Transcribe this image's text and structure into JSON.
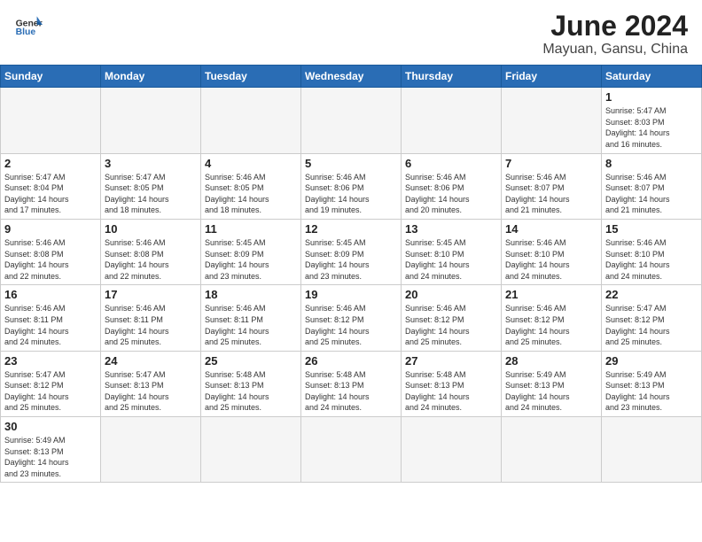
{
  "header": {
    "logo_general": "General",
    "logo_blue": "Blue",
    "title": "June 2024",
    "location": "Mayuan, Gansu, China"
  },
  "weekdays": [
    "Sunday",
    "Monday",
    "Tuesday",
    "Wednesday",
    "Thursday",
    "Friday",
    "Saturday"
  ],
  "days": [
    {
      "num": "",
      "info": ""
    },
    {
      "num": "",
      "info": ""
    },
    {
      "num": "",
      "info": ""
    },
    {
      "num": "",
      "info": ""
    },
    {
      "num": "",
      "info": ""
    },
    {
      "num": "",
      "info": ""
    },
    {
      "num": "1",
      "info": "Sunrise: 5:47 AM\nSunset: 8:03 PM\nDaylight: 14 hours\nand 16 minutes."
    },
    {
      "num": "2",
      "info": "Sunrise: 5:47 AM\nSunset: 8:04 PM\nDaylight: 14 hours\nand 17 minutes."
    },
    {
      "num": "3",
      "info": "Sunrise: 5:47 AM\nSunset: 8:05 PM\nDaylight: 14 hours\nand 18 minutes."
    },
    {
      "num": "4",
      "info": "Sunrise: 5:46 AM\nSunset: 8:05 PM\nDaylight: 14 hours\nand 18 minutes."
    },
    {
      "num": "5",
      "info": "Sunrise: 5:46 AM\nSunset: 8:06 PM\nDaylight: 14 hours\nand 19 minutes."
    },
    {
      "num": "6",
      "info": "Sunrise: 5:46 AM\nSunset: 8:06 PM\nDaylight: 14 hours\nand 20 minutes."
    },
    {
      "num": "7",
      "info": "Sunrise: 5:46 AM\nSunset: 8:07 PM\nDaylight: 14 hours\nand 21 minutes."
    },
    {
      "num": "8",
      "info": "Sunrise: 5:46 AM\nSunset: 8:07 PM\nDaylight: 14 hours\nand 21 minutes."
    },
    {
      "num": "9",
      "info": "Sunrise: 5:46 AM\nSunset: 8:08 PM\nDaylight: 14 hours\nand 22 minutes."
    },
    {
      "num": "10",
      "info": "Sunrise: 5:46 AM\nSunset: 8:08 PM\nDaylight: 14 hours\nand 22 minutes."
    },
    {
      "num": "11",
      "info": "Sunrise: 5:45 AM\nSunset: 8:09 PM\nDaylight: 14 hours\nand 23 minutes."
    },
    {
      "num": "12",
      "info": "Sunrise: 5:45 AM\nSunset: 8:09 PM\nDaylight: 14 hours\nand 23 minutes."
    },
    {
      "num": "13",
      "info": "Sunrise: 5:45 AM\nSunset: 8:10 PM\nDaylight: 14 hours\nand 24 minutes."
    },
    {
      "num": "14",
      "info": "Sunrise: 5:46 AM\nSunset: 8:10 PM\nDaylight: 14 hours\nand 24 minutes."
    },
    {
      "num": "15",
      "info": "Sunrise: 5:46 AM\nSunset: 8:10 PM\nDaylight: 14 hours\nand 24 minutes."
    },
    {
      "num": "16",
      "info": "Sunrise: 5:46 AM\nSunset: 8:11 PM\nDaylight: 14 hours\nand 24 minutes."
    },
    {
      "num": "17",
      "info": "Sunrise: 5:46 AM\nSunset: 8:11 PM\nDaylight: 14 hours\nand 25 minutes."
    },
    {
      "num": "18",
      "info": "Sunrise: 5:46 AM\nSunset: 8:11 PM\nDaylight: 14 hours\nand 25 minutes."
    },
    {
      "num": "19",
      "info": "Sunrise: 5:46 AM\nSunset: 8:12 PM\nDaylight: 14 hours\nand 25 minutes."
    },
    {
      "num": "20",
      "info": "Sunrise: 5:46 AM\nSunset: 8:12 PM\nDaylight: 14 hours\nand 25 minutes."
    },
    {
      "num": "21",
      "info": "Sunrise: 5:46 AM\nSunset: 8:12 PM\nDaylight: 14 hours\nand 25 minutes."
    },
    {
      "num": "22",
      "info": "Sunrise: 5:47 AM\nSunset: 8:12 PM\nDaylight: 14 hours\nand 25 minutes."
    },
    {
      "num": "23",
      "info": "Sunrise: 5:47 AM\nSunset: 8:12 PM\nDaylight: 14 hours\nand 25 minutes."
    },
    {
      "num": "24",
      "info": "Sunrise: 5:47 AM\nSunset: 8:13 PM\nDaylight: 14 hours\nand 25 minutes."
    },
    {
      "num": "25",
      "info": "Sunrise: 5:48 AM\nSunset: 8:13 PM\nDaylight: 14 hours\nand 25 minutes."
    },
    {
      "num": "26",
      "info": "Sunrise: 5:48 AM\nSunset: 8:13 PM\nDaylight: 14 hours\nand 24 minutes."
    },
    {
      "num": "27",
      "info": "Sunrise: 5:48 AM\nSunset: 8:13 PM\nDaylight: 14 hours\nand 24 minutes."
    },
    {
      "num": "28",
      "info": "Sunrise: 5:49 AM\nSunset: 8:13 PM\nDaylight: 14 hours\nand 24 minutes."
    },
    {
      "num": "29",
      "info": "Sunrise: 5:49 AM\nSunset: 8:13 PM\nDaylight: 14 hours\nand 23 minutes."
    },
    {
      "num": "30",
      "info": "Sunrise: 5:49 AM\nSunset: 8:13 PM\nDaylight: 14 hours\nand 23 minutes."
    }
  ]
}
